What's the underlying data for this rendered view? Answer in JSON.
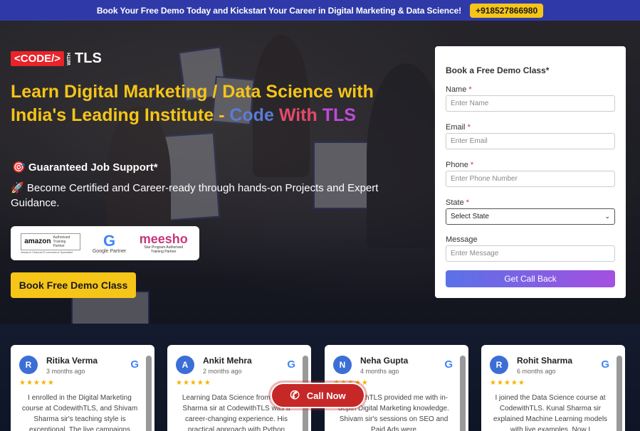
{
  "topbar": {
    "text": "Book Your Free Demo Today and Kickstart Your Career in Digital Marketing & Data Science!",
    "phone": "+918527866980"
  },
  "logo": {
    "code": "<CODE/>",
    "with": "WITH",
    "tls": "TLS"
  },
  "hero": {
    "headline_main": "Learn Digital Marketing / Data Science with India's Leading Institute - ",
    "headline_code": "Code",
    "headline_with": "With",
    "headline_tls": "TLS",
    "feature1_icon": "🎯",
    "feature1": "Guaranteed Job Support*",
    "feature2_icon": "🚀",
    "feature2": "Become Certified and Career-ready through hands-on Projects and Expert Guidance.",
    "partners": {
      "amazon_name": "amazon",
      "amazon_sub": "Authorised Training Partner",
      "amazon_footer": "Amazon Channel E-commerce Specialist",
      "google_label": "Google Partner",
      "meesho_name": "meesho",
      "meesho_sub": "Star Program Authorised Training Partner"
    },
    "demo_button": "Book Free Demo Class"
  },
  "form": {
    "title": "Book a Free Demo Class*",
    "name_label": "Name",
    "name_placeholder": "Enter Name",
    "email_label": "Email",
    "email_placeholder": "Enter Email",
    "phone_label": "Phone",
    "phone_placeholder": "Enter Phone Number",
    "state_label": "State",
    "state_value": "Select State",
    "message_label": "Message",
    "message_placeholder": "Enter Message",
    "submit": "Get Call Back",
    "required_mark": "*"
  },
  "reviews": [
    {
      "initial": "R",
      "name": "Ritika Verma",
      "time": "3 months ago",
      "stars": "★★★★★",
      "text": "I enrolled in the Digital Marketing course at CodewithTLS, and Shivam Sharma sir's teaching style is exceptional. The live campaigns"
    },
    {
      "initial": "A",
      "name": "Ankit Mehra",
      "time": "2 months ago",
      "stars": "★★★★★",
      "text": "Learning Data Science from Kunal Sharma sir at CodewithTLS was a career-changing experience. His practical approach with Python"
    },
    {
      "initial": "N",
      "name": "Neha Gupta",
      "time": "4 months ago",
      "stars": "★★★★★",
      "text": "CodewithTLS provided me with in-depth Digital Marketing knowledge. Shivam sir's sessions on SEO and Paid Ads were"
    },
    {
      "initial": "R",
      "name": "Rohit Sharma",
      "time": "6 months ago",
      "stars": "★★★★★",
      "text": "I joined the Data Science course at CodewithTLS. Kunal Sharma sir explained Machine Learning models with live examples. Now I"
    }
  ],
  "google_mark": "G",
  "call_now": {
    "label": "Call Now",
    "icon": "phone-icon"
  }
}
